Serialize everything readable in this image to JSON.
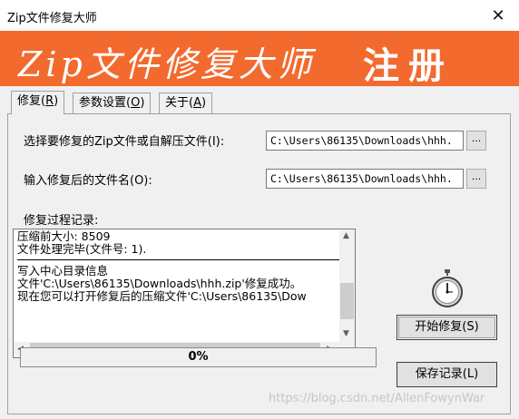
{
  "window": {
    "title": "Zip文件修复大师",
    "close_glyph": "✕"
  },
  "banner": {
    "title": "Zip文件修复大师",
    "register": "注册",
    "color": "#f26a2e"
  },
  "tabs": [
    {
      "label": "修复",
      "accel": "R",
      "active": true
    },
    {
      "label": "参数设置",
      "accel": "O",
      "active": false
    },
    {
      "label": "关于",
      "accel": "A",
      "active": false
    }
  ],
  "form": {
    "source_label": "选择要修复的Zip文件或自解压文件(I):",
    "source_value": "C:\\Users\\86135\\Downloads\\hhh.",
    "dest_label": "输入修复后的文件名(O):",
    "dest_value": "C:\\Users\\86135\\Downloads\\hhh.",
    "browse_label": "..."
  },
  "log": {
    "label": "修复过程记录:",
    "lines_before_sep": [
      "压缩前大小: 8509",
      "文件处理完毕(文件号: 1)."
    ],
    "lines_after_sep": [
      "写入中心目录信息",
      "文件'C:\\Users\\86135\\Downloads\\hhh.zip'修复成功。",
      "现在您可以打开修复后的压缩文件'C:\\Users\\86135\\Dow"
    ]
  },
  "progress": {
    "text": "0%",
    "value": 0
  },
  "buttons": {
    "start": "开始修复(S)",
    "save": "保存记录(L)"
  },
  "icons": {
    "stopwatch": "stopwatch-icon"
  },
  "watermark": "https://blog.csdn.net/AllenFowynWar"
}
